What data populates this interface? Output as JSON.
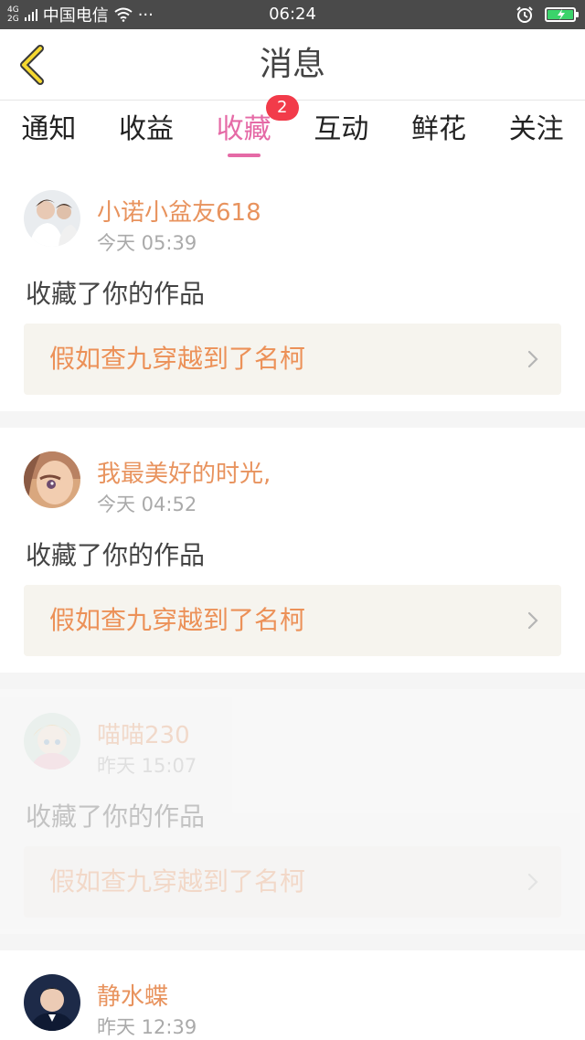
{
  "status_bar": {
    "network_top": "4G",
    "network_bottom": "2G",
    "carrier": "中国电信",
    "more": "···",
    "time": "06:24"
  },
  "header": {
    "back_icon": "chevron-left-icon",
    "title": "消息"
  },
  "tabs": [
    {
      "label": "通知"
    },
    {
      "label": "收益"
    },
    {
      "label": "收藏",
      "badge": "2",
      "active": true
    },
    {
      "label": "互动"
    },
    {
      "label": "鲜花"
    },
    {
      "label": "关注"
    }
  ],
  "colors": {
    "accent_pink": "#e56aa6",
    "badge_red": "#f23b4a",
    "username_orange": "#e8935e",
    "work_title_orange": "#ec9158"
  },
  "messages": [
    {
      "user": "小诺小盆友618",
      "time": "今天 05:39",
      "action": "收藏了你的作品",
      "work": "假如查九穿越到了名柯"
    },
    {
      "user": "我最美好的时光,",
      "time": "今天 04:52",
      "action": "收藏了你的作品",
      "work": "假如查九穿越到了名柯"
    },
    {
      "user": "喵喵230",
      "time": "昨天 15:07",
      "action": "收藏了你的作品",
      "work": "假如查九穿越到了名柯"
    },
    {
      "user": "静水蝶",
      "time": "昨天 12:39"
    }
  ]
}
